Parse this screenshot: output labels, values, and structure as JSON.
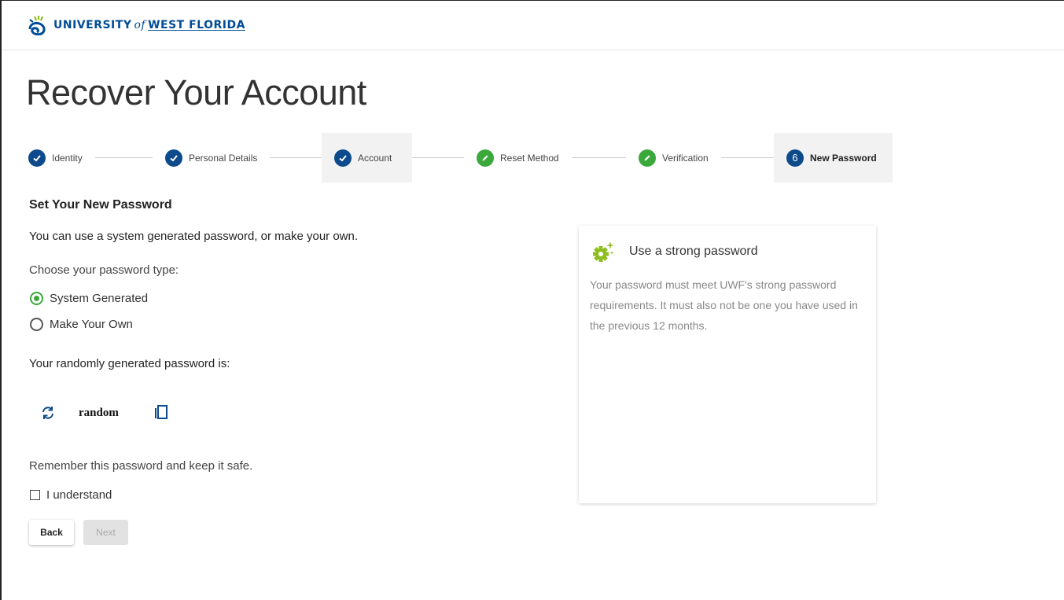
{
  "header": {
    "logo_university": "UNIVERSITY",
    "logo_of": "of",
    "logo_west_florida": "WEST FLORIDA"
  },
  "page": {
    "title": "Recover Your Account"
  },
  "stepper": {
    "steps": [
      {
        "label": "Identity",
        "state": "complete",
        "icon": "check-icon"
      },
      {
        "label": "Personal Details",
        "state": "complete",
        "icon": "check-icon"
      },
      {
        "label": "Account",
        "state": "complete",
        "icon": "check-icon"
      },
      {
        "label": "Reset Method",
        "state": "edited",
        "icon": "pencil-icon"
      },
      {
        "label": "Verification",
        "state": "edited",
        "icon": "pencil-icon"
      },
      {
        "label": "New Password",
        "state": "active",
        "number": "6"
      }
    ]
  },
  "form": {
    "section_title": "Set Your New Password",
    "intro": "You can use a system generated password, or make your own.",
    "choose_label": "Choose your password type:",
    "options": [
      {
        "label": "System Generated",
        "selected": true
      },
      {
        "label": "Make Your Own",
        "selected": false
      }
    ],
    "generated_label": "Your randomly generated password is:",
    "password_value": "random",
    "remember_text": "Remember this password and keep it safe.",
    "understand_label": "I understand",
    "understand_checked": false,
    "back_label": "Back",
    "next_label": "Next"
  },
  "tip_card": {
    "title": "Use a strong password",
    "body": "Your password must meet UWF's strong password requirements. It must also not be one you have used in the previous 12 months."
  },
  "colors": {
    "brand_blue": "#0c4a8c",
    "success_green": "#3aa83a",
    "accent_lime": "#8dbd1f"
  }
}
